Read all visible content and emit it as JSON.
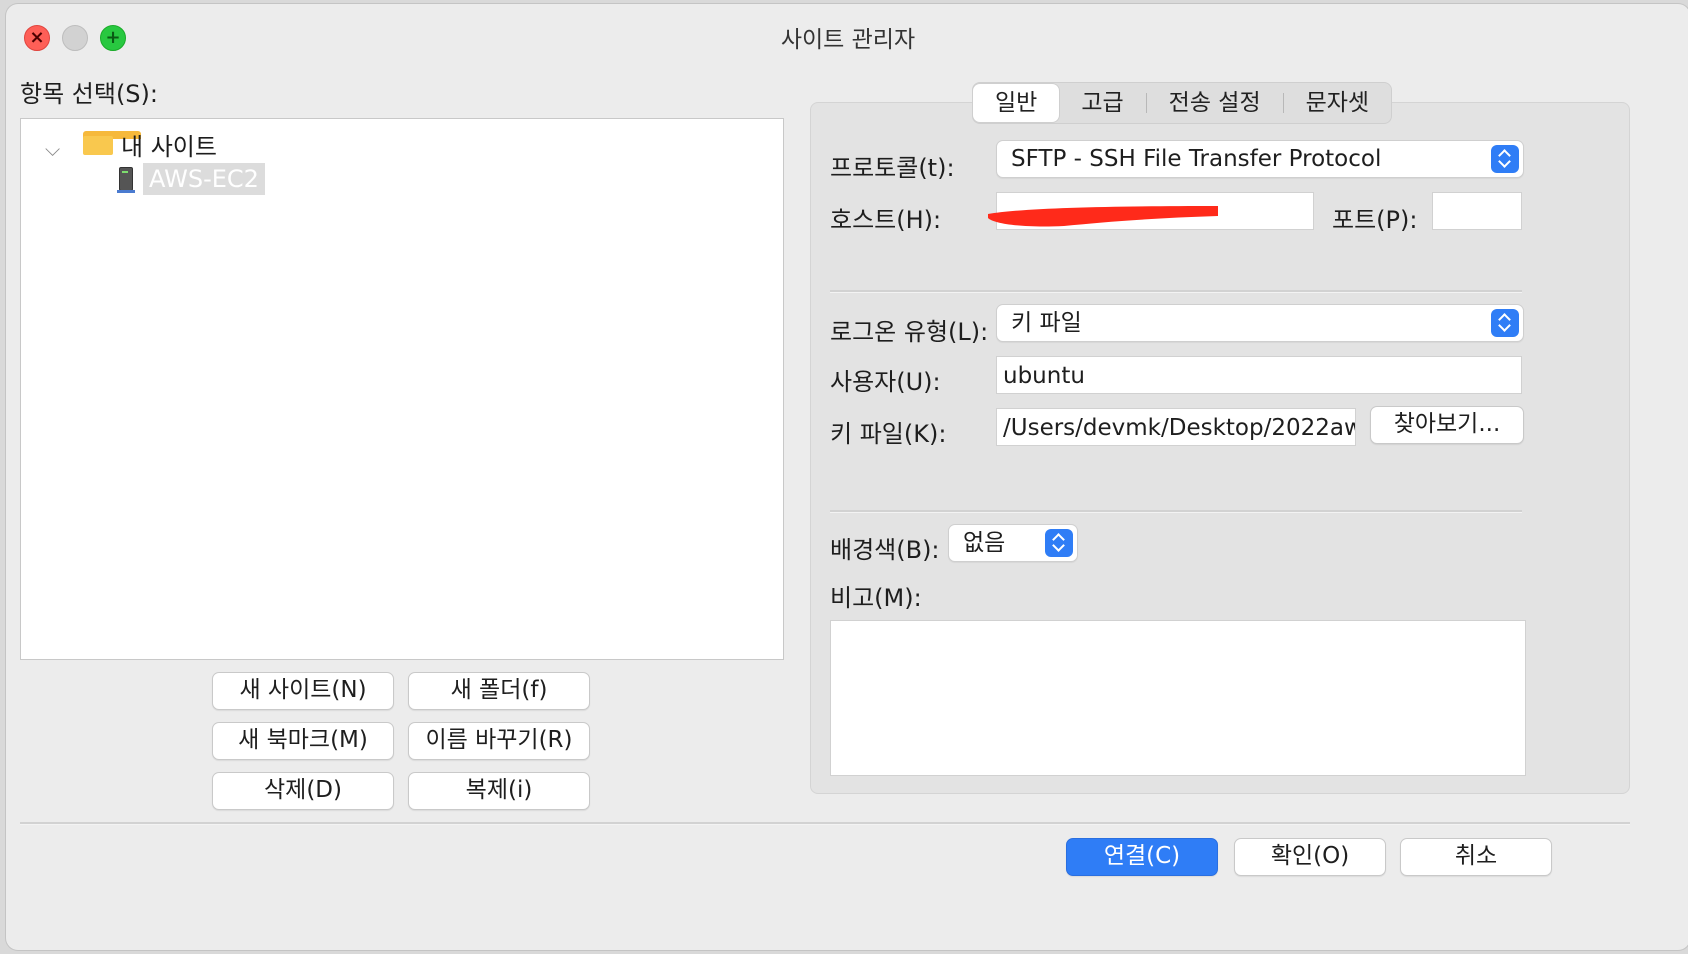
{
  "window": {
    "title": "사이트 관리자"
  },
  "left": {
    "select_label": "항목 선택(S):",
    "tree": {
      "root_label": "내 사이트",
      "items": [
        {
          "label": "AWS-EC2"
        }
      ]
    },
    "buttons": {
      "new_site": "새 사이트(N)",
      "new_folder": "새 폴더(f)",
      "new_bookmark": "새 북마크(M)",
      "rename": "이름 바꾸기(R)",
      "delete": "삭제(D)",
      "duplicate": "복제(i)"
    }
  },
  "tabs": [
    {
      "label": "일반",
      "active": true
    },
    {
      "label": "고급",
      "active": false
    },
    {
      "label": "전송 설정",
      "active": false
    },
    {
      "label": "문자셋",
      "active": false
    }
  ],
  "general": {
    "protocol": {
      "label": "프로토콜(t):",
      "value": "SFTP - SSH File Transfer Protocol"
    },
    "host": {
      "label": "호스트(H):",
      "value": ""
    },
    "port": {
      "label": "포트(P):",
      "value": ""
    },
    "logon_type": {
      "label": "로그온 유형(L):",
      "value": "키 파일"
    },
    "user": {
      "label": "사용자(U):",
      "value": "ubuntu"
    },
    "key_file": {
      "label": "키 파일(K):",
      "value": "/Users/devmk/Desktop/2022aw",
      "browse": "찾아보기..."
    },
    "background": {
      "label": "배경색(B):",
      "value": "없음"
    },
    "comments": {
      "label": "비고(M):",
      "value": ""
    }
  },
  "footer": {
    "connect": "연결(C)",
    "ok": "확인(O)",
    "cancel": "취소"
  },
  "colors": {
    "accent": "#2f7df6",
    "close": "#fe5f57",
    "zoom": "#28c840",
    "redaction": "#ff2a1a"
  }
}
